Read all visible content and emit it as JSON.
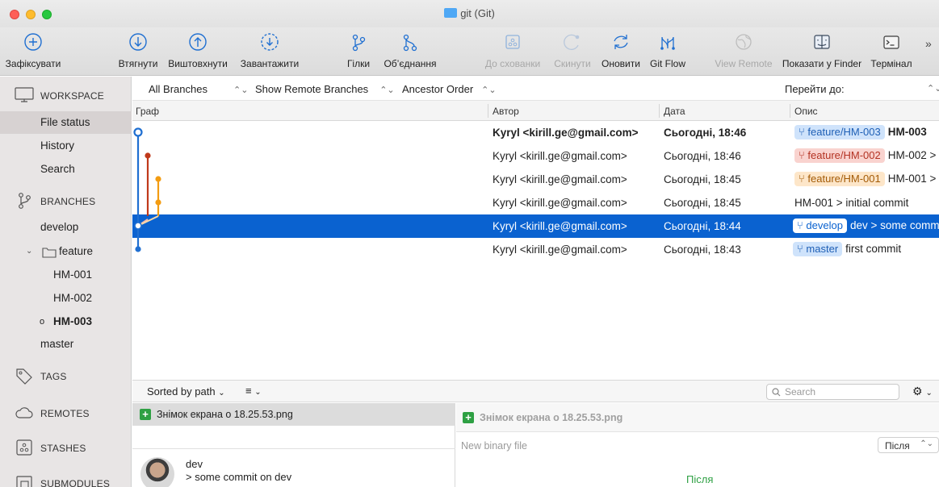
{
  "window": {
    "title": "git (Git)"
  },
  "toolbar": {
    "buttons": [
      {
        "label": "Зафіксувати",
        "icon": "commit-plus-icon",
        "enabled": true
      },
      {
        "label": "Втягнути",
        "icon": "pull-down-arrow-icon",
        "enabled": true
      },
      {
        "label": "Виштовхнути",
        "icon": "push-up-arrow-icon",
        "enabled": true
      },
      {
        "label": "Завантажити",
        "icon": "fetch-icon",
        "enabled": true
      },
      {
        "label": "Гілки",
        "icon": "branch-icon",
        "enabled": true
      },
      {
        "label": "Об’єднання",
        "icon": "merge-icon",
        "enabled": true
      },
      {
        "label": "До схованки",
        "icon": "stash-icon",
        "enabled": false
      },
      {
        "label": "Скинути",
        "icon": "discard-icon",
        "enabled": false
      },
      {
        "label": "Оновити",
        "icon": "refresh-icon",
        "enabled": true
      },
      {
        "label": "Git Flow",
        "icon": "git-flow-icon",
        "enabled": true
      },
      {
        "label": "View Remote",
        "icon": "globe-icon",
        "enabled": false
      },
      {
        "label": "Показати у Finder",
        "icon": "finder-icon",
        "enabled": true
      },
      {
        "label": "Термінал",
        "icon": "terminal-icon",
        "enabled": true
      }
    ],
    "overflow": "»"
  },
  "sidebar": {
    "workspace": "WORKSPACE",
    "workspace_items": [
      "File status",
      "History",
      "Search"
    ],
    "branches": "BRANCHES",
    "branch_develop": "develop",
    "feature_folder": "feature",
    "feature_branches": [
      "HM-001",
      "HM-002",
      "HM-003"
    ],
    "branch_master": "master",
    "tags": "TAGS",
    "remotes": "REMOTES",
    "stashes": "STASHES",
    "submodules": "SUBMODULES"
  },
  "filters": {
    "branches": "All Branches",
    "remote": "Show Remote Branches",
    "order": "Ancestor Order",
    "jump_to": "Перейти до:"
  },
  "columns": {
    "graph": "Граф",
    "author": "Автор",
    "date": "Дата",
    "description": "Опис"
  },
  "commits": [
    {
      "author": "Kyryl <kirill.ge@gmail.com>",
      "date": "Сьогодні, 18:46",
      "tag": "feature/HM-003",
      "tag_color": "#cfe3fb",
      "message": "HM-003"
    },
    {
      "author": "Kyryl <kirill.ge@gmail.com>",
      "date": "Сьогодні, 18:46",
      "tag": "feature/HM-002",
      "tag_color": "#f9d3cf",
      "message": "HM-002 >"
    },
    {
      "author": "Kyryl <kirill.ge@gmail.com>",
      "date": "Сьогодні, 18:45",
      "tag": "feature/HM-001",
      "tag_color": "#fde6c9",
      "message": "HM-001 >"
    },
    {
      "author": "Kyryl <kirill.ge@gmail.com>",
      "date": "Сьогодні, 18:45",
      "tag": "",
      "message": "HM-001 > initial commit"
    },
    {
      "author": "Kyryl <kirill.ge@gmail.com>",
      "date": "Сьогодні, 18:44",
      "tag": "develop",
      "message": "dev > some comm"
    },
    {
      "author": "Kyryl <kirill.ge@gmail.com>",
      "date": "Сьогодні, 18:43",
      "tag": "master",
      "message": "first commit"
    }
  ],
  "bottom": {
    "sort": "Sorted by path",
    "search_placeholder": "Search",
    "file_name": "Знімок екрана  о 18.25.53.png",
    "commit_branch": "dev",
    "commit_message": "> some commit on dev",
    "diff_file": "Знімок екрана  о 18.25.53.png",
    "diff_info": "New binary file",
    "diff_select": "Після",
    "diff_after_label": "Після"
  },
  "colors": {
    "selection": "#0a62d0",
    "branch_blue": "#1f6fd1",
    "branch_red": "#c0391b",
    "branch_orange": "#f39c12"
  }
}
